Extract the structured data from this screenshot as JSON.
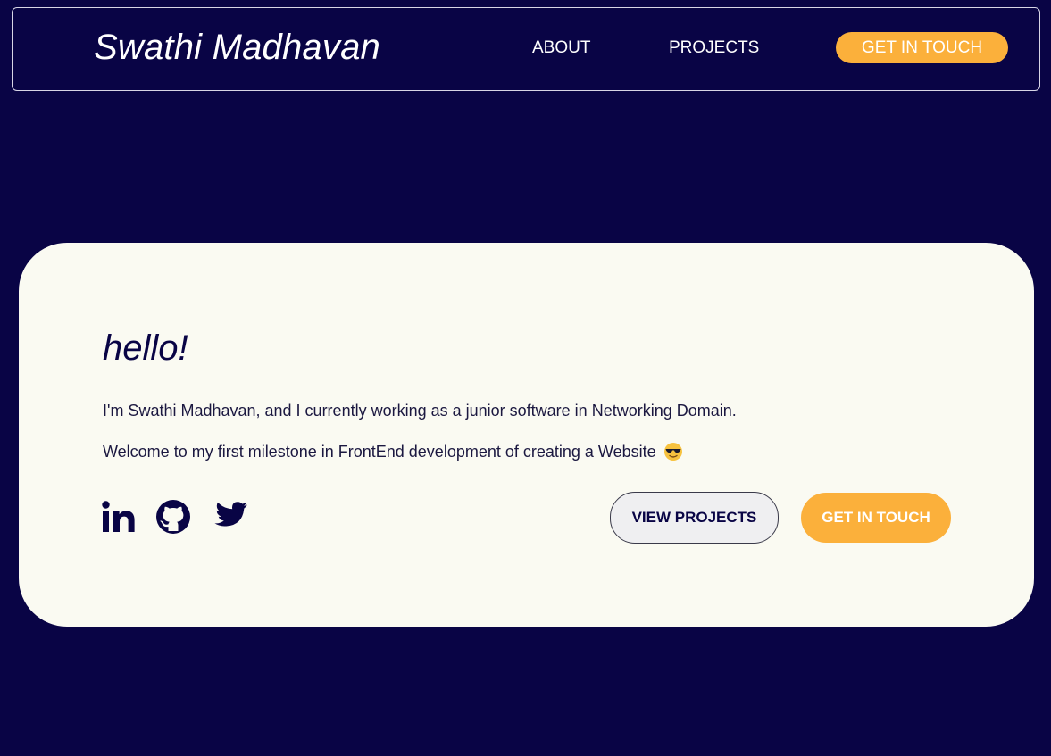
{
  "nav": {
    "brand": "Swathi Madhavan",
    "about_label": "ABOUT",
    "projects_label": "PROJECTS",
    "cta_label": "GET IN TOUCH"
  },
  "hero": {
    "greeting": "hello!",
    "intro": "I'm Swathi Madhavan, and I currently working as a junior software in Networking Domain.",
    "welcome": "Welcome to my first milestone in FrontEnd development of creating a Website",
    "emoji": "smiling-face-with-sunglasses-icon",
    "socials": [
      "linkedin-icon",
      "github-icon",
      "twitter-icon"
    ],
    "view_projects_label": "VIEW PROJECTS",
    "get_in_touch_label": "GET IN TOUCH"
  },
  "colors": {
    "background": "#090445",
    "card": "#fafaf2",
    "accent": "#fbb03b",
    "text_dark": "#090445"
  }
}
